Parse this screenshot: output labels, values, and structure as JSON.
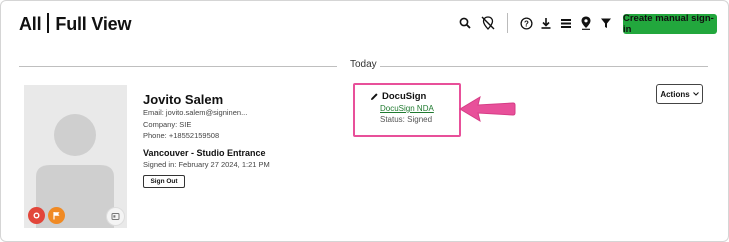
{
  "header": {
    "title_left": "All",
    "title_right": "Full View",
    "create_button": "Create manual sign-in",
    "toolbar_icons": [
      "search-icon",
      "hide-location-icon",
      "help-icon",
      "download-icon",
      "list-icon",
      "location-pin-icon",
      "filter-icon"
    ]
  },
  "timeline": {
    "date_label": "Today"
  },
  "visitor": {
    "name": "Jovito Salem",
    "email": "Email: jovito.salem@signinen...",
    "company": "Company: SIE",
    "phone": "Phone: +18552159508",
    "location": "Vancouver - Studio Entrance",
    "signed_in": "Signed in: February 27 2024, 1:21 PM",
    "sign_out_label": "Sign Out"
  },
  "document": {
    "title": "DocuSign",
    "link": "DocuSign NDA",
    "status": "Status: Signed"
  },
  "actions": {
    "label": "Actions"
  },
  "colors": {
    "accent": "#22a73d",
    "highlight": "#e8509a",
    "badge_red": "#e2463a",
    "badge_orange": "#f08a24"
  }
}
